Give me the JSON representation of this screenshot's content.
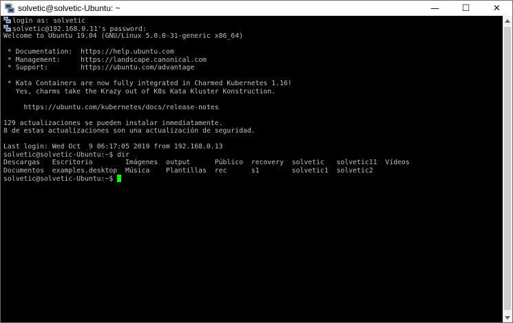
{
  "window": {
    "title": "solvetic@solvetic-Ubuntu: ~",
    "controls": {
      "minimize": "—",
      "maximize": "☐",
      "close": "✕"
    }
  },
  "colors": {
    "background": "#000000",
    "text": "#c0c0c0",
    "cursor": "#00ff00"
  },
  "terminal": {
    "lines": [
      "login as: solvetic",
      "solvetic@192.168.0.11's password:",
      "Welcome to Ubuntu 19.04 (GNU/Linux 5.0.0-31-generic x86_64)",
      "",
      " * Documentation:  https://help.ubuntu.com",
      " * Management:     https://landscape.canonical.com",
      " * Support:        https://ubuntu.com/advantage",
      "",
      " * Kata Containers are now fully integrated in Charmed Kubernetes 1.16!",
      "   Yes, charms take the Krazy out of K8s Kata Kluster Konstruction.",
      "",
      "     https://ubuntu.com/kubernetes/docs/release-notes",
      "",
      "129 actualizaciones se pueden instalar inmediatamente.",
      "8 de estas actualizaciones son una actualización de seguridad.",
      "",
      "Last login: Wed Oct  9 06:17:05 2019 from 192.168.0.13",
      "solvetic@solvetic-Ubuntu:~$ dir",
      "Descargas   Escritorio        Imágenes  output      Público  recovery  solvetic   solvetic11  Vídeos",
      "Documentos  examples.desktop  Música    Plantillas  rec      s1        solvetic1  solvetic2",
      "solvetic@solvetic-Ubuntu:~$ "
    ]
  }
}
